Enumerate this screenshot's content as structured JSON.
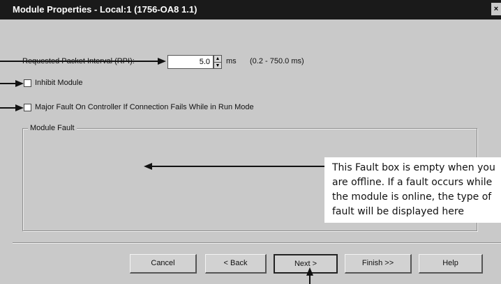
{
  "window": {
    "title": "Module Properties - Local:1 (1756-OA8 1.1)",
    "close_glyph": "×"
  },
  "rpi": {
    "label": "Requested Packet Interval (RPI):",
    "value": "5.0",
    "unit": "ms",
    "range": "(0.2 - 750.0 ms)"
  },
  "inhibit": {
    "label": "Inhibit Module",
    "checked": false
  },
  "major_fault": {
    "label": "Major Fault On Controller If Connection Fails While in Run Mode",
    "checked": false
  },
  "module_fault": {
    "legend": "Module Fault"
  },
  "callout": {
    "lines": [
      "This Fault box is empty when you",
      "are offline. If a fault occurs while",
      "the module is online, the type of",
      "fault will be displayed here"
    ]
  },
  "buttons": {
    "cancel": "Cancel",
    "back": "< Back",
    "next": "Next >",
    "finish": "Finish >>",
    "help": "Help"
  },
  "icons": {
    "spin_up": "▲",
    "spin_down": "▼"
  }
}
